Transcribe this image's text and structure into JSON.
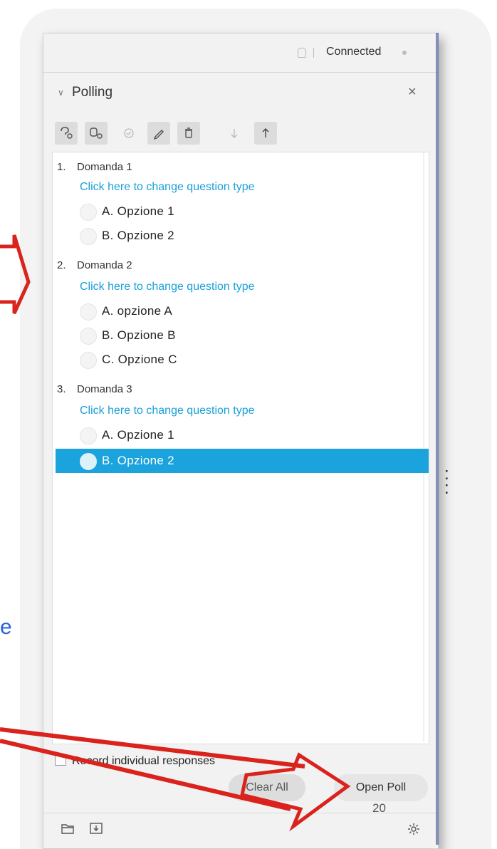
{
  "status": {
    "text": "Connected"
  },
  "panel": {
    "title": "Polling",
    "close_glyph": "×",
    "collapse_glyph": "∨"
  },
  "toolbar": {
    "icons": [
      "add-question-icon",
      "add-question-group-icon",
      "check-icon",
      "edit-icon",
      "delete-icon",
      "move-down-icon",
      "move-up-icon"
    ]
  },
  "questions": [
    {
      "number": "1.",
      "title": "Domanda 1",
      "change_type_link": "Click here to change question type",
      "options": [
        "A. Opzione 1",
        "B. Opzione 2"
      ]
    },
    {
      "number": "2.",
      "title": "Domanda 2",
      "change_type_link": "Click here to change question type",
      "options": [
        "A. opzione A",
        "B. Opzione B",
        "C. Opzione C"
      ]
    },
    {
      "number": "3.",
      "title": "Domanda 3",
      "change_type_link": "Click here to change question type",
      "options": [
        "A. Opzione 1",
        "B. Opzione 2"
      ],
      "selected_option": "B. Opzione 2"
    }
  ],
  "record_label": "Record individual responses",
  "buttons": {
    "clear_all": "Clear All",
    "open_poll": "Open Poll"
  },
  "page_number": "20",
  "colors": {
    "accent": "#1aa3dc",
    "link": "#1aa0d8",
    "annotation_arrow": "#d9231c"
  }
}
